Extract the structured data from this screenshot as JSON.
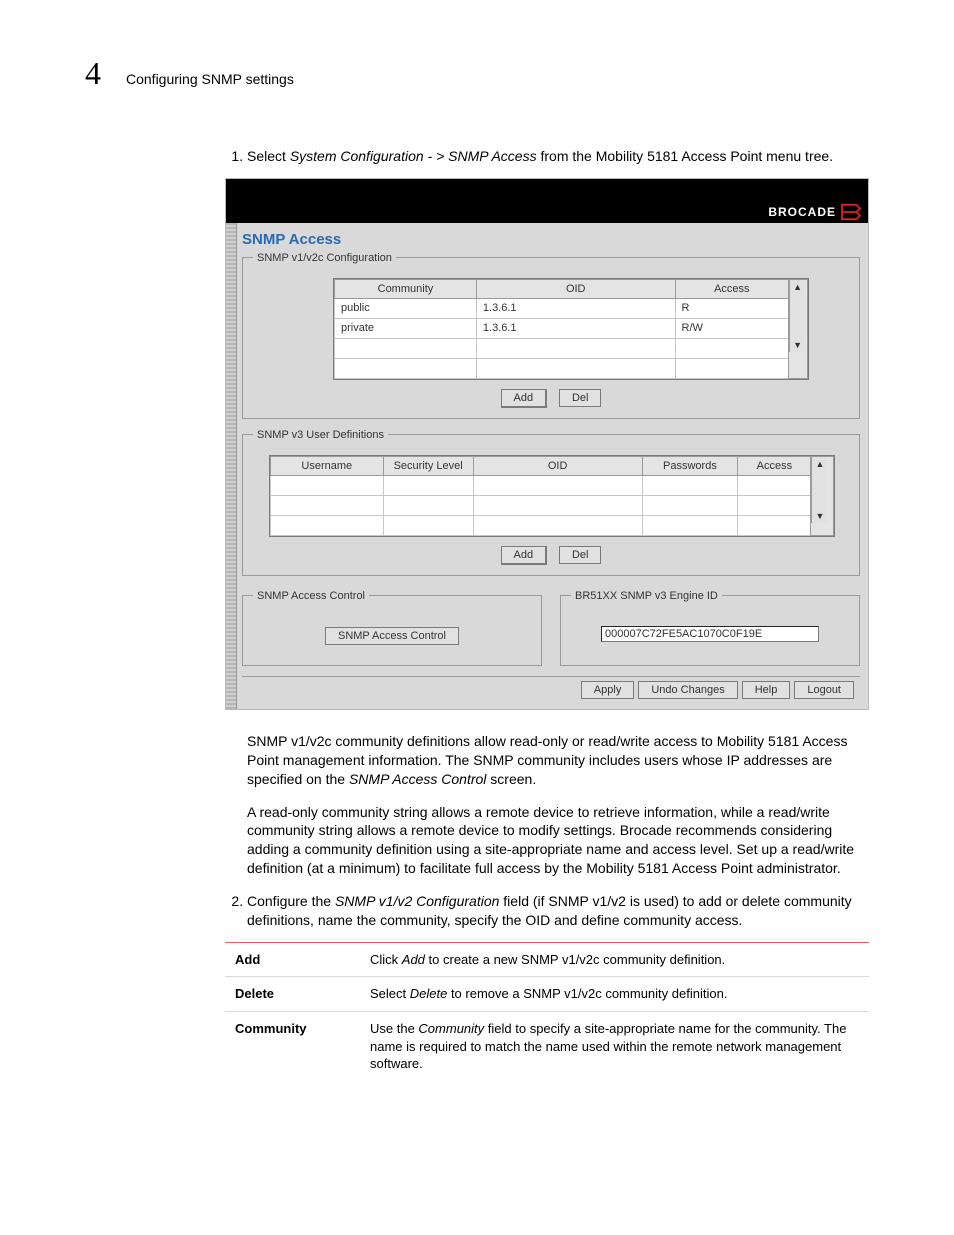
{
  "header": {
    "chapter_number": "4",
    "chapter_title": "Configuring SNMP settings"
  },
  "steps": [
    {
      "text_pre": "Select ",
      "em1": "System Configuration - > SNMP Access",
      "text_post": " from the Mobility 5181 Access Point menu tree."
    },
    {
      "text_pre": "Configure the ",
      "em1": "SNMP v1/v2 Configuration",
      "text_post": " field (if SNMP v1/v2 is used) to add or delete community definitions, name the community, specify the OID and define community access."
    }
  ],
  "screenshot": {
    "brand": "BROCADE",
    "page_title": "SNMP Access",
    "section1_legend": "SNMP v1/v2c Configuration",
    "section2_legend": "SNMP v3 User Definitions",
    "section3_legend": "SNMP Access Control",
    "section4_legend": "BR51XX SNMP v3 Engine ID",
    "table1_headers": [
      "Community",
      "OID",
      "Access"
    ],
    "table1_rows": [
      [
        "public",
        "1.3.6.1",
        "R"
      ],
      [
        "private",
        "1.3.6.1",
        "R/W"
      ]
    ],
    "table2_headers": [
      "Username",
      "Security Level",
      "OID",
      "Passwords",
      "Access"
    ],
    "add_label": "Add",
    "del_label": "Del",
    "access_control_button": "SNMP Access Control",
    "engine_id": "000007C72FE5AC1070C0F19E",
    "footer_buttons": [
      "Apply",
      "Undo Changes",
      "Help",
      "Logout"
    ]
  },
  "body_paragraphs": {
    "p1_pre": "SNMP v1/v2c community definitions allow read-only or read/write access to Mobility 5181 Access Point management information. The SNMP community includes users whose IP addresses are specified on the ",
    "p1_em": "SNMP Access Control",
    "p1_post": " screen.",
    "p2": "A read-only community string allows a remote device to retrieve information, while a read/write community string allows a remote device to modify settings. Brocade recommends considering adding a community definition using a site-appropriate name and access level. Set up a read/write definition (at a minimum) to facilitate full access by the Mobility 5181 Access Point administrator."
  },
  "definitions": [
    {
      "term": "Add",
      "desc_pre": "Click ",
      "desc_em": "Add",
      "desc_post": " to create a new SNMP v1/v2c community definition."
    },
    {
      "term": "Delete",
      "desc_pre": "Select ",
      "desc_em": "Delete",
      "desc_post": " to remove a SNMP v1/v2c community definition."
    },
    {
      "term": "Community",
      "desc_pre": "Use the ",
      "desc_em": "Community",
      "desc_post": " field to specify a site-appropriate name for the community. The name is required to match the name used within the remote network management software."
    }
  ]
}
